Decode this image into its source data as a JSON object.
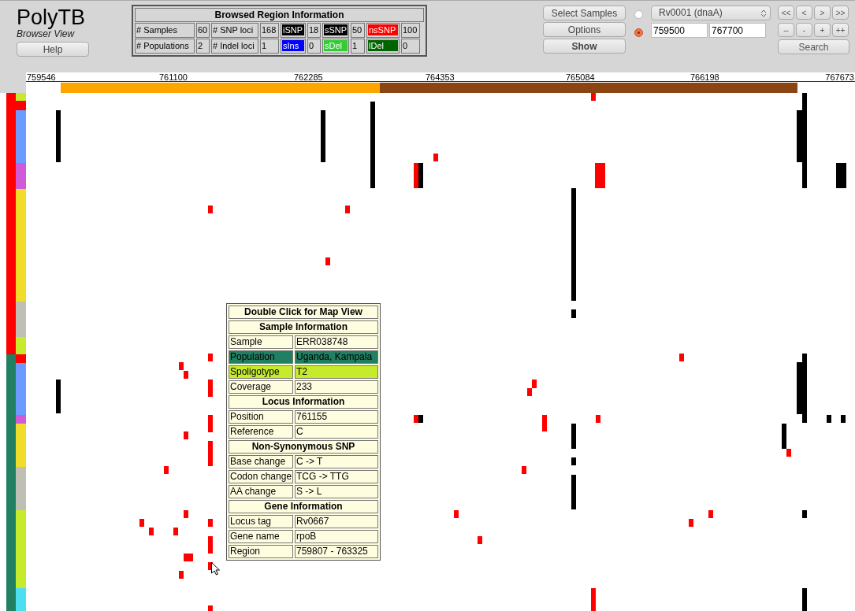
{
  "app": {
    "title": "PolyTB",
    "subtitle": "Browser View",
    "help_button": "Help"
  },
  "region_info": {
    "title": "Browsed Region Information",
    "rows": [
      [
        {
          "text": "# Samples"
        },
        {
          "text": "60"
        },
        {
          "text": "# SNP loci"
        },
        {
          "text": "168"
        },
        {
          "text": "iSNP",
          "color": "#000000"
        },
        {
          "text": "18"
        },
        {
          "text": "sSNP",
          "color": "#000000"
        },
        {
          "text": "50"
        },
        {
          "text": "nsSNP",
          "color": "#ff0000"
        },
        {
          "text": "100"
        }
      ],
      [
        {
          "text": "# Populations"
        },
        {
          "text": "2"
        },
        {
          "text": "# Indel loci"
        },
        {
          "text": "1"
        },
        {
          "text": "sIns",
          "color": "#0000ff"
        },
        {
          "text": "0"
        },
        {
          "text": "sDel",
          "color": "#33cc33"
        },
        {
          "text": "1"
        },
        {
          "text": "lDel",
          "color": "#006400"
        },
        {
          "text": "0"
        }
      ]
    ]
  },
  "buttons": [
    {
      "label": "Select Samples",
      "bold": false
    },
    {
      "label": "Options",
      "bold": false
    },
    {
      "label": "Show",
      "bold": true
    }
  ],
  "radios": [
    {
      "selected": false
    },
    {
      "selected": true
    }
  ],
  "gene_select": "Rv0001 (dnaA)",
  "range": {
    "start": "759500",
    "end": "767700"
  },
  "nav_buttons": [
    [
      "<<",
      "<",
      ">",
      ">>"
    ],
    [
      "--",
      "-",
      "+",
      "++"
    ]
  ],
  "search_button": "Search",
  "axis_labels": [
    "759546",
    "761100",
    "762285",
    "764353",
    "765084",
    "766198",
    "767673"
  ],
  "tooltip": {
    "title": "Double Click for Map View",
    "sections": [
      {
        "heading": "Sample Information",
        "rows": [
          {
            "label": "Sample",
            "value": "ERR038748"
          },
          {
            "label": "Population",
            "value": "Uganda, Kampala",
            "color": "#217f62"
          },
          {
            "label": "Spoligotype",
            "value": "T2",
            "color": "#c6ea2c"
          },
          {
            "label": "Coverage",
            "value": "233"
          }
        ]
      },
      {
        "heading": "Locus Information",
        "rows": [
          {
            "label": "Position",
            "value": "761155"
          },
          {
            "label": "Reference",
            "value": "C"
          }
        ]
      },
      {
        "heading": "Non-Synonymous SNP",
        "rows": [
          {
            "label": "Base change",
            "value": "C -> T"
          },
          {
            "label": "Codon change",
            "value": "TCG -> TTG"
          },
          {
            "label": "AA change",
            "value": "S -> L"
          }
        ]
      },
      {
        "heading": "Gene Information",
        "rows": [
          {
            "label": "Locus tag",
            "value": "Rv0667"
          },
          {
            "label": "Gene name",
            "value": "rpoB"
          },
          {
            "label": "Region",
            "value": "759807 - 763325"
          }
        ]
      }
    ]
  }
}
